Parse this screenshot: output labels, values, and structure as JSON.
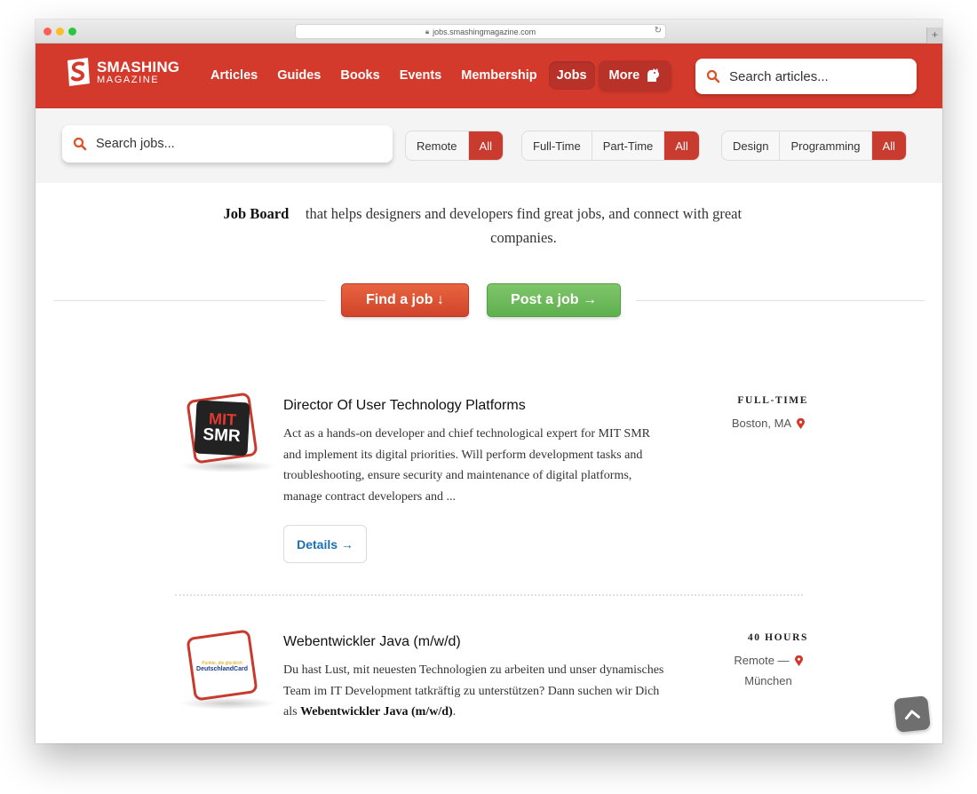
{
  "browser": {
    "url": "jobs.smashingmagazine.com"
  },
  "header": {
    "logo_line1": "SMASHING",
    "logo_line2": "MAGAZINE",
    "nav": [
      "Articles",
      "Guides",
      "Books",
      "Events",
      "Membership",
      "Jobs"
    ],
    "more_label": "More",
    "search_placeholder": "Search articles..."
  },
  "filters": {
    "search_placeholder": "Search jobs...",
    "location": [
      "Remote",
      "All"
    ],
    "employment": [
      "Full-Time",
      "Part-Time",
      "All"
    ],
    "category": [
      "Design",
      "Programming",
      "All"
    ]
  },
  "intro": {
    "bold": "Job Board",
    "rest": "that helps designers and developers find great jobs, and connect with great companies.",
    "find_button": "Find a job ↓",
    "post_button": "Post a job →"
  },
  "jobs": [
    {
      "title": "Director Of User Technology Platforms",
      "description": "Act as a hands-on developer and chief technological expert for MIT SMR and implement its digital priorities. Will perform development tasks and troubleshooting, ensure security and maintenance of digital platforms, manage contract developers and ...",
      "type": "FULL-TIME",
      "location": "Boston, MA",
      "logo_line1": "MIT",
      "logo_line2": "SMR",
      "details_label": "Details →"
    },
    {
      "title": "Webentwickler Java (m/w/d)",
      "description_start": "Du hast Lust, mit neuesten Technologien zu arbeiten und unser dynamisches Team im IT Development tatkräftig zu unterstützen? Dann suchen wir Dich als",
      "description_bold": "Webentwickler Java (m/w/d)",
      "description_end": ".",
      "type": "40 HOURS",
      "location_line1": "Remote —",
      "location_line2": "München",
      "logo_line1": "Punkte, die glücklich",
      "logo_line2": "DeutschlandCard"
    }
  ],
  "colors": {
    "brand_red": "#d33a2c",
    "green": "#5fb04f",
    "link_blue": "#1a6fb8"
  },
  "icons": [
    "search-icon",
    "location-pin-icon",
    "arrow-up-icon",
    "lock-icon",
    "reload-icon"
  ]
}
